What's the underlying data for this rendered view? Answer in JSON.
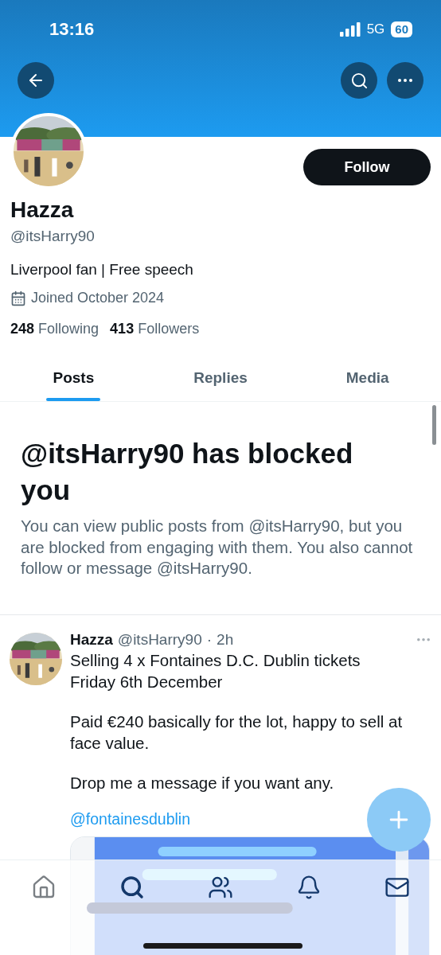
{
  "status_bar": {
    "time": "13:16",
    "network": "5G",
    "battery": "60"
  },
  "profile": {
    "name": "Hazza",
    "handle": "@itsHarry90",
    "bio": "Liverpool fan | Free speech",
    "joined": "Joined October 2024",
    "following_count": "248",
    "following_label": "Following",
    "followers_count": "413",
    "followers_label": "Followers",
    "follow_button": "Follow"
  },
  "tabs": [
    {
      "label": "Posts",
      "selected": true
    },
    {
      "label": "Replies",
      "selected": false
    },
    {
      "label": "Media",
      "selected": false
    }
  ],
  "blocked_notice": {
    "title": "@itsHarry90 has blocked you",
    "message": "You can view public posts from @itsHarry90, but you are blocked from engaging with them. You also cannot follow or message @itsHarry90."
  },
  "posts": [
    {
      "name": "Hazza",
      "handle": "@itsHarry90",
      "separator": "·",
      "time": "2h",
      "paragraphs": [
        "Selling 4 x Fontaines D.C. Dublin tickets\nFriday 6th December",
        "Paid €240 basically for the lot, happy to sell at face value.",
        "Drop me a message if you want any."
      ],
      "mention": "@fontainesdublin"
    }
  ]
}
